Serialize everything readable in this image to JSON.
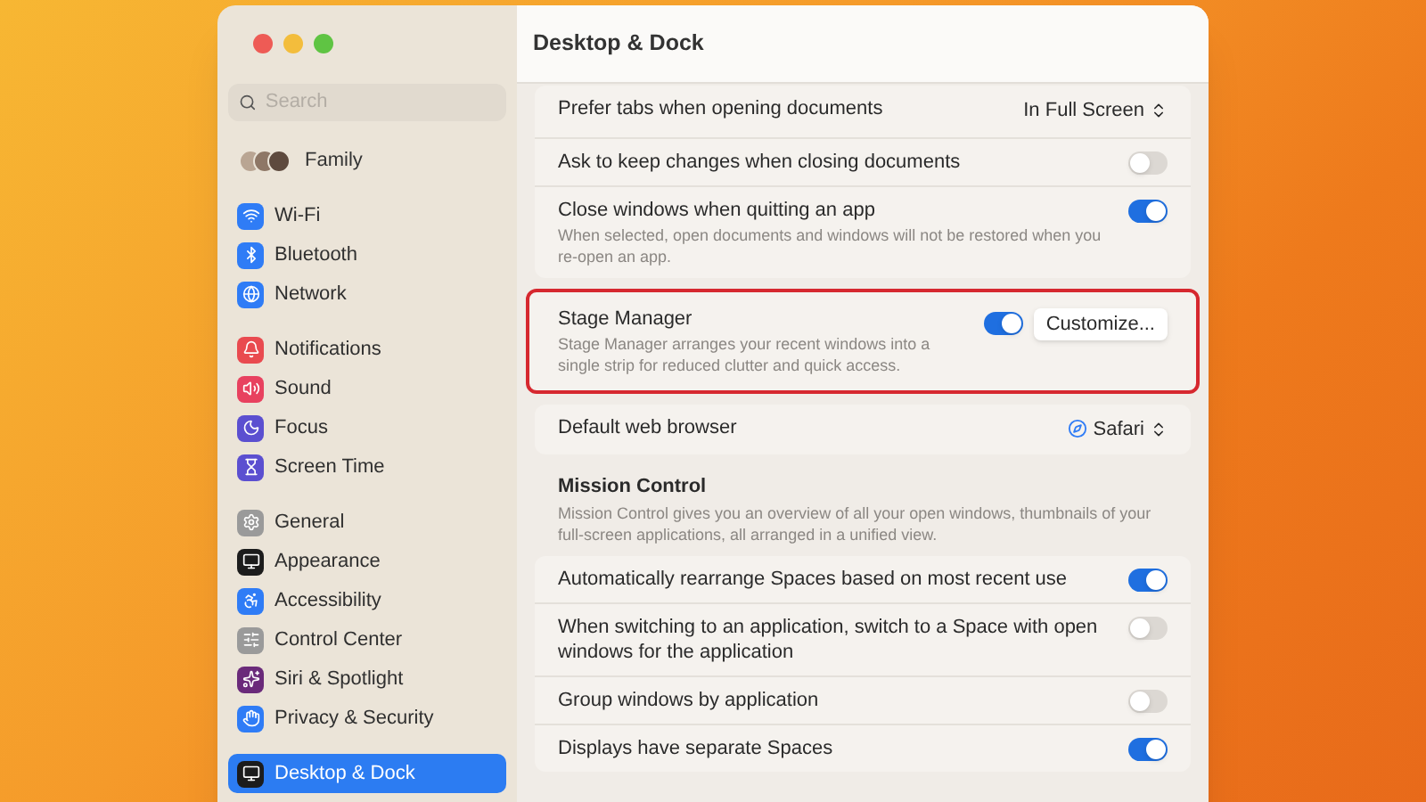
{
  "window": {
    "title": "Desktop & Dock"
  },
  "sidebar": {
    "search": {
      "placeholder": "Search"
    },
    "family": {
      "label": "Family"
    },
    "groups": [
      [
        {
          "label": "Wi-Fi",
          "color": "#2f7cf6",
          "selected": false
        },
        {
          "label": "Bluetooth",
          "color": "#2f7cf6",
          "selected": false
        },
        {
          "label": "Network",
          "color": "#2f7cf6",
          "selected": false
        }
      ],
      [
        {
          "label": "Notifications",
          "color": "#e94a4f",
          "selected": false
        },
        {
          "label": "Sound",
          "color": "#e8415f",
          "selected": false
        },
        {
          "label": "Focus",
          "color": "#5b4fd0",
          "selected": false
        },
        {
          "label": "Screen Time",
          "color": "#5b4fd0",
          "selected": false
        }
      ],
      [
        {
          "label": "General",
          "color": "#9a9a9a",
          "selected": false
        },
        {
          "label": "Appearance",
          "color": "#1c1c1c",
          "selected": false
        },
        {
          "label": "Accessibility",
          "color": "#2f7cf6",
          "selected": false
        },
        {
          "label": "Control Center",
          "color": "#9a9a9a",
          "selected": false
        },
        {
          "label": "Siri & Spotlight",
          "color": "#6a2a7a",
          "selected": false
        },
        {
          "label": "Privacy & Security",
          "color": "#2f7cf6",
          "selected": false
        }
      ],
      [
        {
          "label": "Desktop & Dock",
          "color": "#1c1c1c",
          "selected": true
        }
      ]
    ]
  },
  "content": [
    {
      "kind": "group",
      "highlighted": false,
      "rows": [
        {
          "kind": "popup",
          "label": "Prefer tabs when opening documents",
          "value": "In Full Screen"
        },
        {
          "kind": "toggle",
          "label": "Ask to keep changes when closing documents",
          "on": false
        },
        {
          "kind": "toggle",
          "label": "Close windows when quitting an app",
          "description": "When selected, open documents and windows will not be restored when you re-open an app.",
          "on": true
        }
      ]
    },
    {
      "kind": "group",
      "highlighted": true,
      "rows": [
        {
          "kind": "toggle",
          "label": "Stage Manager",
          "description": "Stage Manager arranges your recent windows into a single strip for reduced clutter and quick access.",
          "on": true,
          "button": "Customize..."
        }
      ]
    },
    {
      "kind": "group",
      "highlighted": false,
      "rows": [
        {
          "kind": "popup",
          "label": "Default web browser",
          "value": "Safari",
          "app_icon": true
        }
      ]
    },
    {
      "kind": "section",
      "title": "Mission Control",
      "description": "Mission Control gives you an overview of all your open windows, thumbnails of your full-screen applications, all arranged in a unified view."
    },
    {
      "kind": "group",
      "highlighted": false,
      "rows": [
        {
          "kind": "toggle",
          "label": "Automatically rearrange Spaces based on most recent use",
          "on": true
        },
        {
          "kind": "toggle",
          "label": "When switching to an application, switch to a Space with open windows for the application",
          "on": false
        },
        {
          "kind": "toggle",
          "label": "Group windows by application",
          "on": false
        },
        {
          "kind": "toggle",
          "label": "Displays have separate Spaces",
          "on": true
        }
      ]
    }
  ]
}
